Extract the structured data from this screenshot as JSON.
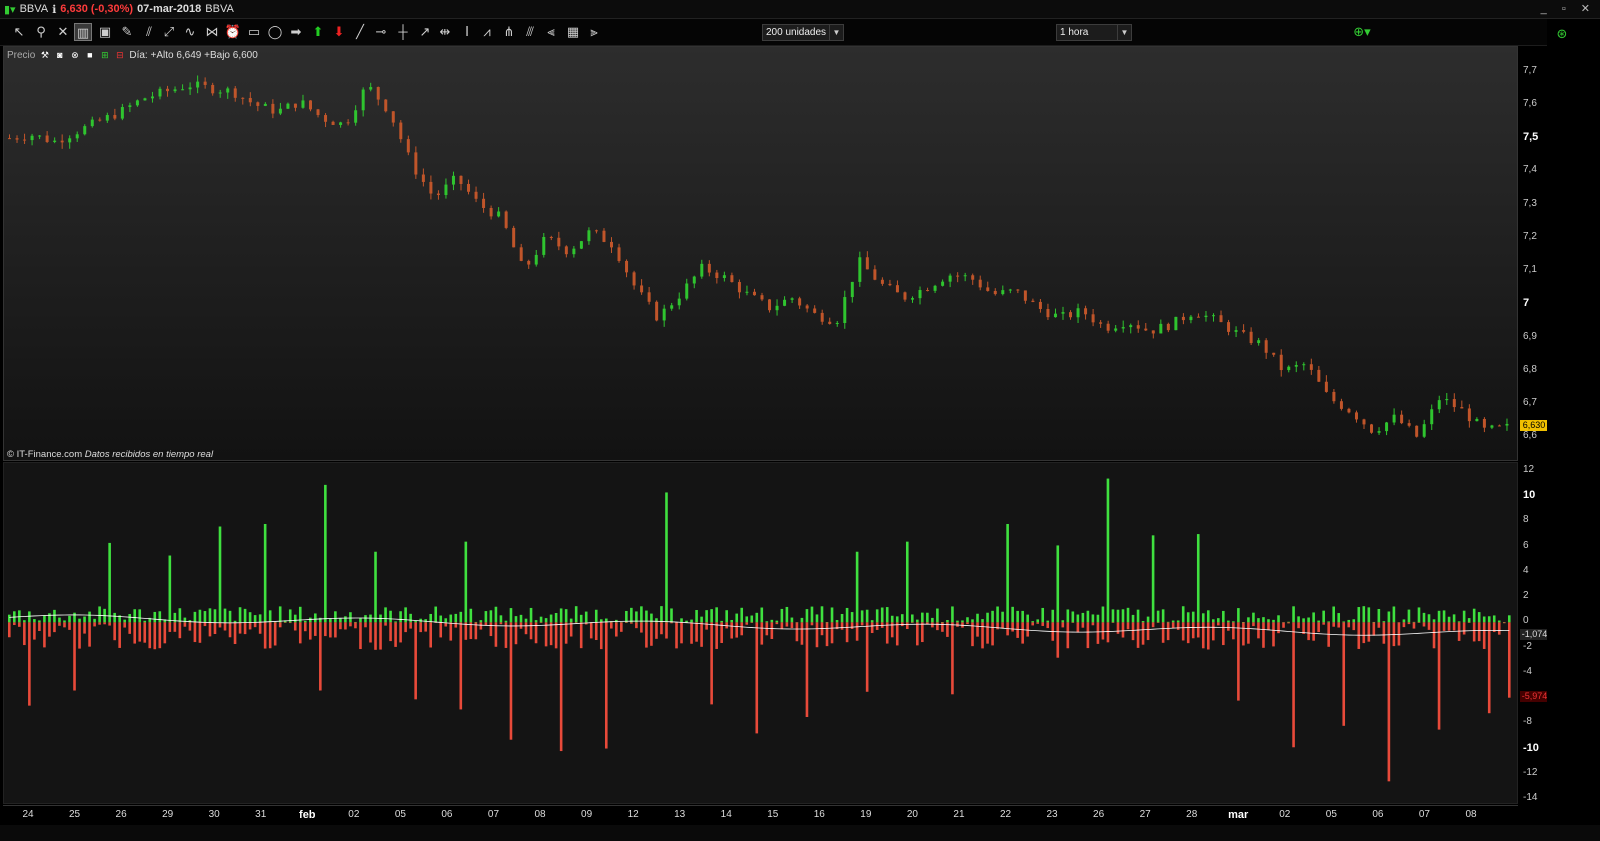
{
  "window": {
    "ticker": "BBVA",
    "price_change": "6,630 (-0,30%)",
    "date": "07-mar-2018",
    "ticker2": "BBVA",
    "controls": "_ ▫ ✕"
  },
  "toolbar": {
    "units_select": "200 unidades",
    "interval_select": "1 hora"
  },
  "price_panel": {
    "label": "Precio",
    "info": "Día: +Alto 6,649 +Bajo 6,600",
    "credit_source": "© IT-Finance.com",
    "credit_note": "Datos recibidos en tiempo real",
    "last_price": "6,630",
    "y_ticks": [
      "7,7",
      "7,6",
      "7,5",
      "7,4",
      "7,3",
      "7,2",
      "7,1",
      "7",
      "6,9",
      "6,8",
      "6,7",
      "6,6"
    ]
  },
  "volume_panel": {
    "y_ticks": [
      "12",
      "10",
      "8",
      "6",
      "4",
      "2",
      "0",
      "-2",
      "-4",
      "-6",
      "-8",
      "-10",
      "-12",
      "-14"
    ],
    "avg_label": "-1,0744",
    "last_label": "-5,9740"
  },
  "x_axis": {
    "labels": [
      "24",
      "25",
      "26",
      "29",
      "30",
      "31",
      "feb",
      "02",
      "05",
      "06",
      "07",
      "08",
      "09",
      "12",
      "13",
      "14",
      "15",
      "16",
      "19",
      "20",
      "21",
      "22",
      "23",
      "26",
      "27",
      "28",
      "mar",
      "02",
      "05",
      "06",
      "07",
      "08"
    ]
  },
  "colors": {
    "up": "#3fe03f",
    "down": "#e84a3a",
    "candle_up": "#2fc42f",
    "candle_down": "#c0552a",
    "last_price_bg": "#f0c000"
  },
  "chart_data": {
    "type": "candlestick+bar",
    "price_series_close": [
      7.5,
      7.51,
      7.49,
      7.52,
      7.55,
      7.58,
      7.62,
      7.64,
      7.66,
      7.65,
      7.64,
      7.6,
      7.58,
      7.61,
      7.56,
      7.54,
      7.66,
      7.58,
      7.42,
      7.32,
      7.38,
      7.3,
      7.26,
      7.1,
      7.2,
      7.16,
      7.22,
      7.18,
      7.05,
      6.96,
      7.03,
      7.11,
      7.08,
      7.03,
      6.99,
      7.02,
      6.97,
      6.95,
      7.13,
      7.06,
      7.02,
      7.05,
      7.09,
      7.08,
      7.03,
      7.04,
      6.99,
      6.96,
      6.98,
      6.93,
      6.95,
      6.92,
      6.94,
      6.98,
      6.95,
      6.91,
      6.88,
      6.8,
      6.82,
      6.72,
      6.68,
      6.62,
      6.66,
      6.6,
      6.72,
      6.68,
      6.62,
      6.63
    ],
    "volume_ylim": [
      -14,
      12
    ],
    "price_ylim": [
      6.55,
      7.75
    ],
    "volume_avg": -1.0744,
    "volume_last": -5.974
  }
}
